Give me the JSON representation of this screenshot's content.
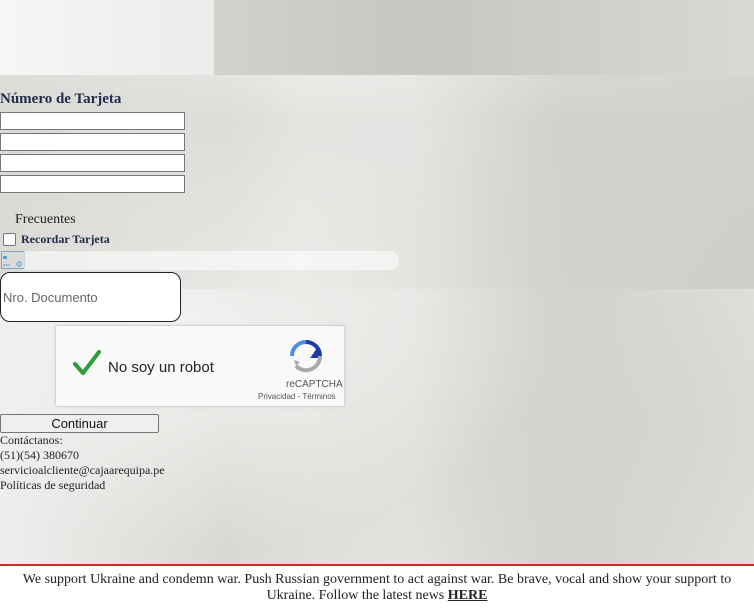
{
  "form": {
    "card_label": "Número de Tarjeta",
    "frequent_label": "Frecuentes",
    "remember_label": "Recordar Tarjeta",
    "document_placeholder": "Nro. Documento",
    "continue_label": "Continuar"
  },
  "captcha": {
    "label": "No soy un robot",
    "brand": "reCAPTCHA",
    "terms": "Privacidad - Términos"
  },
  "contact": {
    "title": "Contáctanos:",
    "phone": "(51)(54) 380670",
    "email": "servicioalcliente@cajaarequipa.pe",
    "policies": "Políticas de seguridad"
  },
  "banner": {
    "text": "We support Ukraine and condemn war. Push Russian government to act against war. Be brave, vocal and show your support to Ukraine. Follow the latest news",
    "link": "HERE"
  }
}
